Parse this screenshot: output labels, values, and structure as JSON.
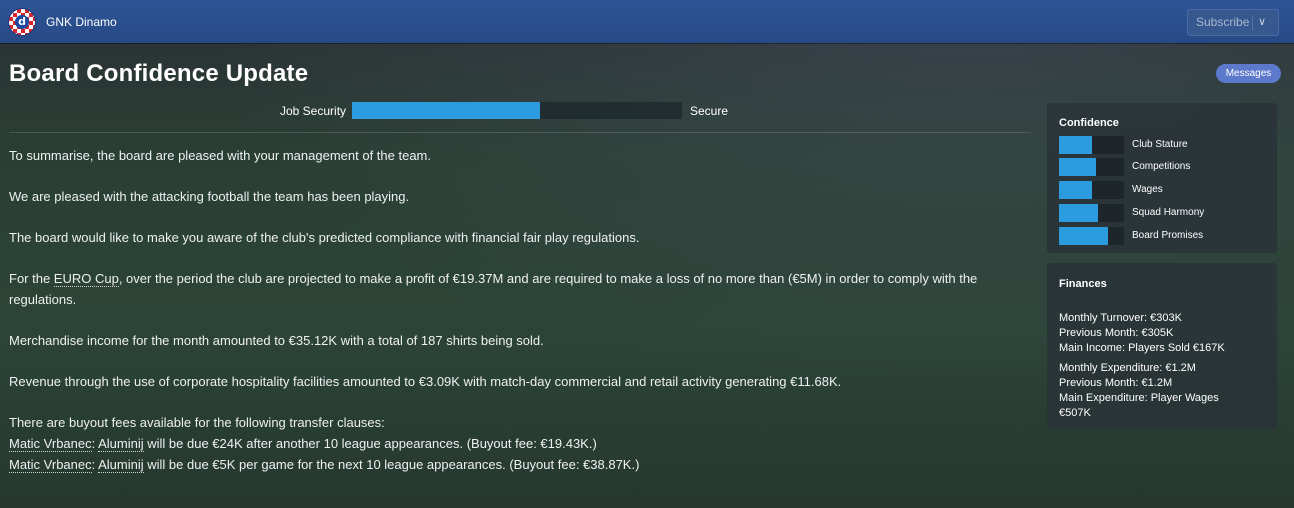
{
  "header": {
    "club_name": "GNK Dinamo",
    "subscribe_label": "Subscribe",
    "brand_color": "#2e5597"
  },
  "page": {
    "title": "Board Confidence Update",
    "messages_label": "Messages"
  },
  "job_security": {
    "label": "Job Security",
    "value_text": "Secure",
    "level": 0.57
  },
  "body": {
    "p1": "To summarise, the board are pleased with your management of the team.",
    "p2": "We are pleased with the attacking football the team has been playing.",
    "p3": "The board would like to make you aware of the club's predicted compliance with financial fair play regulations.",
    "p4_before": "For the ",
    "p4_link": "EURO Cup",
    "p4_after": ", over the period the club are projected to make a profit of €19.37M and are required to make a loss of no more than (€5M) in order to comply with the regulations.",
    "p5": "Merchandise income for the month amounted to €35.12K with a total of 187 shirts being sold.",
    "p6": "Revenue through the use of corporate hospitality facilities amounted to €3.09K with match-day commercial and retail activity generating €11.68K.",
    "p7": "There are buyout fees available for the following transfer clauses:",
    "clauses": [
      {
        "player": "Matic Vrbanec",
        "sep": ": ",
        "club": "Aluminij",
        "text": " will be due €24K after another 10 league appearances. (Buyout fee: €19.43K.)"
      },
      {
        "player": "Matic Vrbanec",
        "sep": ": ",
        "club": "Aluminij",
        "text": " will be due €5K per game for the next 10 league appearances. (Buyout fee: €38.87K.)"
      }
    ]
  },
  "confidence": {
    "title": "Confidence",
    "items": [
      {
        "label": "Club Stature",
        "level": 0.5
      },
      {
        "label": "Competitions",
        "level": 0.57
      },
      {
        "label": "Wages",
        "level": 0.5
      },
      {
        "label": "Squad Harmony",
        "level": 0.6
      },
      {
        "label": "Board Promises",
        "level": 0.76
      }
    ]
  },
  "finances": {
    "title": "Finances",
    "lines": [
      "Monthly Turnover: €303K",
      "Previous Month: €305K",
      "Main Income: Players Sold €167K",
      "Monthly Expenditure: €1.2M",
      "Previous Month: €1.2M",
      "Main Expenditure: Player Wages",
      "€507K"
    ]
  },
  "colors": {
    "accent_bar": "#2d9be0",
    "messages_badge": "#5d79cc"
  }
}
